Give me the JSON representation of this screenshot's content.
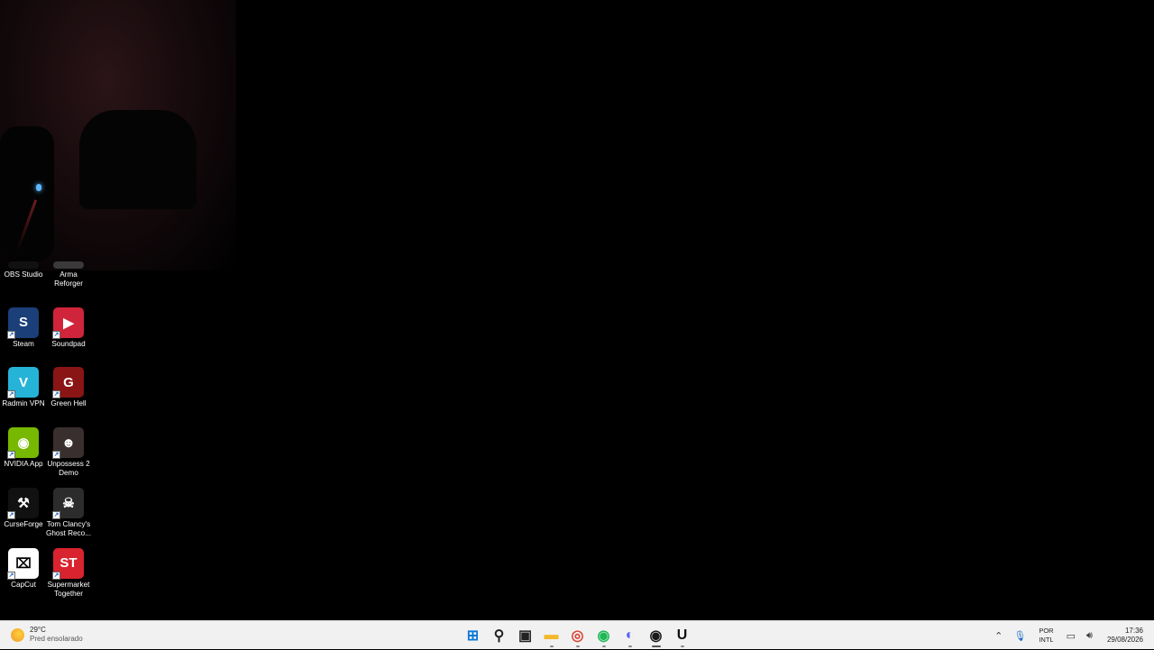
{
  "desktop_icons": [
    {
      "label": "OBS Studio",
      "color": "#111111",
      "glyph": ""
    },
    {
      "label": "Arma Reforger",
      "color": "#3a3a3a",
      "glyph": ""
    },
    {
      "label": "Steam",
      "color": "#1b3f78",
      "glyph": "S"
    },
    {
      "label": "Soundpad",
      "color": "#d0243a",
      "glyph": "▶"
    },
    {
      "label": "Radmin VPN",
      "color": "#25b4d8",
      "glyph": "V"
    },
    {
      "label": "Green Hell",
      "color": "#8a1515",
      "glyph": "G"
    },
    {
      "label": "NVIDIA App",
      "color": "#76b900",
      "glyph": "◉"
    },
    {
      "label": "Unpossess 2 Demo",
      "color": "#3a2f2f",
      "glyph": "☻"
    },
    {
      "label": "CurseForge",
      "color": "#111111",
      "glyph": "⚒"
    },
    {
      "label": "Tom Clancy's Ghost Reco...",
      "color": "#2c2c2c",
      "glyph": "☠"
    },
    {
      "label": "CapCut",
      "color": "#ffffff",
      "glyph": "⌧"
    },
    {
      "label": "Supermarket Together",
      "color": "#d9232e",
      "glyph": "ST"
    }
  ],
  "taskbar": {
    "weather": {
      "temp": "29°C",
      "condition": "Pred ensolarado"
    },
    "apps": [
      {
        "name": "windows-start",
        "glyph": "⊞",
        "color": "#0a78d7"
      },
      {
        "name": "search",
        "glyph": "⚲",
        "color": "#222"
      },
      {
        "name": "task-view",
        "glyph": "▣",
        "color": "#222"
      },
      {
        "name": "file-explorer",
        "glyph": "▬",
        "color": "#f3b82a"
      },
      {
        "name": "chrome",
        "glyph": "◎",
        "color": "#db4437"
      },
      {
        "name": "spotify",
        "glyph": "◉",
        "color": "#1db954"
      },
      {
        "name": "discord",
        "glyph": "◐",
        "color": "#5865f2"
      },
      {
        "name": "obs",
        "glyph": "◉",
        "color": "#1a1a1a"
      },
      {
        "name": "unreal",
        "glyph": "U",
        "color": "#111"
      }
    ],
    "tray": {
      "language": "POR",
      "layout": "INTL",
      "time": "17:36",
      "date": "29/08/2026"
    }
  }
}
